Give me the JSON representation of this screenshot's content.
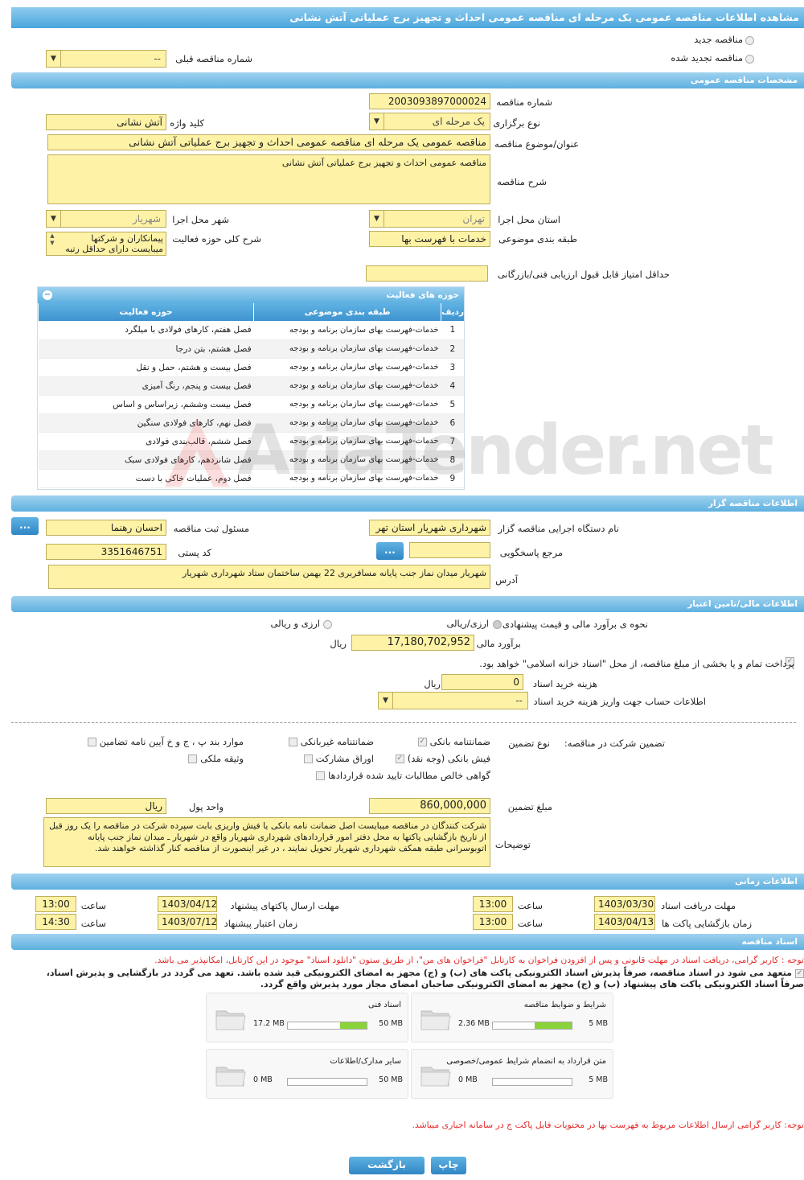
{
  "title": "مشاهده اطلاعات مناقصه عمومی یک مرحله ای مناقصه عمومی احداث و تجهیز برج عملیاتی آتش نشانی",
  "top": {
    "new_label": "مناقصه جدید",
    "renewed_label": "مناقصه تجدید شده",
    "prev_label": "شماره مناقصه قبلی",
    "prev_value": "--"
  },
  "general": {
    "header": "مشخصات مناقصه عمومی",
    "number_label": "شماره مناقصه",
    "number": "2003093897000024",
    "type_label": "نوع برگزاری",
    "type": "یک مرحله ای",
    "keyword_label": "کلید واژه",
    "keyword": "آتش نشانی",
    "subject_label": "عنوان/موضوع مناقصه",
    "subject": "مناقصه عمومی یک مرحله ای  مناقصه عمومی احداث و تجهیز برج عملیاتی آتش نشانی",
    "desc_label": "شرح مناقصه",
    "desc": "مناقصه عمومی احداث و تجهیز برج عملیاتی آتش نشانی",
    "province_label": "استان محل اجرا",
    "province": "تهران",
    "city_label": "شهر محل اجرا",
    "city": "شهریار",
    "category_label": "طبقه بندی موضوعی",
    "category": "خدمات با فهرست بها",
    "scope_label": "شرح کلی حوزه فعالیت",
    "scope": "پیمانکاران و شرکتها میبایست دارای حداقل رتبه",
    "min_score_label": "حداقل امتیاز قابل قبول ارزیابی فنی/بازرگانی",
    "min_score": ""
  },
  "activities": {
    "header": "حوزه های فعالیت",
    "cols": [
      "ردیف",
      "طبقه بندی موضوعی",
      "حوزه فعالیت"
    ],
    "rows": [
      [
        "1",
        "خدمات-فهرست بهای سازمان برنامه و بودجه",
        "فصل هفتم، کارهای فولادی با میلگرد"
      ],
      [
        "2",
        "خدمات-فهرست بهای سازمان برنامه و بودجه",
        "فصل هشتم، بتن درجا"
      ],
      [
        "3",
        "خدمات-فهرست بهای سازمان برنامه و بودجه",
        "فصل بیست و هشتم، حمل و نقل"
      ],
      [
        "4",
        "خدمات-فهرست بهای سازمان برنامه و بودجه",
        "فصل بیست و پنجم، رنگ آمیزی"
      ],
      [
        "5",
        "خدمات-فهرست بهای سازمان برنامه و بودجه",
        "فصل بیست وششم، زیراساس و اساس"
      ],
      [
        "6",
        "خدمات-فهرست بهای سازمان برنامه و بودجه",
        "فصل نهم، کارهای فولادی سنگین"
      ],
      [
        "7",
        "خدمات-فهرست بهای سازمان برنامه و بودجه",
        "فصل ششم، قالب‌بندی فولادی"
      ],
      [
        "8",
        "خدمات-فهرست بهای سازمان برنامه و بودجه",
        "فصل شانزدهم، کارهای فولادی سبک"
      ],
      [
        "9",
        "خدمات-فهرست بهای سازمان برنامه و بودجه",
        "فصل دوم، عملیات خاکی با دست"
      ]
    ]
  },
  "organizer": {
    "header": "اطلاعات مناقصه گزار",
    "org_label": "نام دستگاه اجرایی مناقصه گزار",
    "org": "شهرداری شهریار استان تهر",
    "officer_label": "مسئول ثبت مناقصه",
    "officer": "احسان رهنما",
    "ref_label": "مرجع پاسخگویی",
    "ref": "",
    "postal_label": "کد پستی",
    "postal": "3351646751",
    "address_label": "آدرس",
    "address": "شهریار میدان نماز  جنب پایانه مسافربری  22 بهمن ساختمان ستاد شهرداری شهریار",
    "btn": "..."
  },
  "finance": {
    "header": "اطلاعات مالی/تامین اعتبار",
    "method_label": "نحوه ی برآورد مالی و قیمت پیشنهادی",
    "opt1": "ارزی/ریالی",
    "opt2": "ارزی و ریالی",
    "estimate_label": "برآورد مالی",
    "estimate": "17,180,702,952",
    "rial": "ریال",
    "treasury": "پرداخت تمام و یا بخشی از مبلغ مناقصه، از محل \"اسناد خزانه اسلامی\" خواهد بود.",
    "doc_cost_label": "هزینه خرید اسناد",
    "doc_cost": "0",
    "account_label": "اطلاعات حساب جهت واریز هزینه خرید اسناد",
    "account": "--"
  },
  "guarantee": {
    "title_label": "تضمین شرکت در مناقصه:",
    "type_label": "نوع تضمین",
    "opts": [
      "ضمانتنامه بانکی",
      "ضمانتنامه غیربانکی",
      "موارد بند پ ، ج و خ آیین نامه تضامین",
      "فیش بانکی (وجه نقد)",
      "اوراق مشارکت",
      "وثیقه ملکی",
      "گواهی خالص مطالبات تایید شده قراردادها"
    ],
    "amount_label": "مبلغ تضمین",
    "amount": "860,000,000",
    "unit_label": "واحد پول",
    "unit": "ریال",
    "notes_label": "توضیحات",
    "notes": "شرکت کنندگان در مناقصه میبایست اصل ضمانت نامه بانکی یا فیش واریزی بابت سپرده شرکت در مناقصه را یک روز قبل از تاریخ بازگشایی پاکتها به محل دفتر امور قراردادهای شهرداری شهریار واقع در شهریار ـ میدان نماز جنب پایانه اتوبوسرانی طبقه همکف شهرداری شهریار تحویل نمایند ، در غیر اینصورت از مناقصه کنار گذاشته خواهند شد."
  },
  "timing": {
    "header": "اطلاعات زمانی",
    "receive_label": "مهلت دریافت اسناد",
    "receive_date": "1403/03/30",
    "receive_time": "13:00",
    "send_label": "مهلت ارسال پاکتهای پیشنهاد",
    "send_date": "1403/04/12",
    "send_time": "13:00",
    "open_label": "زمان بازگشایی پاکت ها",
    "open_date": "1403/04/13",
    "open_time": "13:00",
    "valid_label": "زمان اعتبار پیشنهاد",
    "valid_date": "1403/07/12",
    "valid_time": "14:30",
    "time_label": "ساعت"
  },
  "docs": {
    "header": "اسناد مناقصه",
    "note1": "توجه : کاربر گرامی، دریافت اسناد در مهلت قانونی و پس از افزودن فراخوان به کارتابل \"فراخوان های من\"، از طریق ستون \"دانلود اسناد\" موجود در این کارتابل، امکانپذیر می باشد.",
    "note2": "متعهد می شود در اسناد مناقصه، صرفاً پذیرش اسناد الکترونیکی پاکت های (ب) و (ج) مجهز به امضای الکترونیکی قید شده باشد. تعهد می گردد در بازگشایی و پذیرش اسناد،",
    "note3": "صرفاً اسناد الکترونیکی پاکت های پیشنهاد (ب) و (ج) مجهز به امضای الکترونیکی صاحبان امضای مجاز مورد پذیرش واقع گردد.",
    "files": [
      {
        "name": "شرایط و ضوابط مناقصه",
        "current": "2.36 MB",
        "max": "5 MB",
        "fill": 0.47
      },
      {
        "name": "اسناد فنی",
        "current": "17.2 MB",
        "max": "50 MB",
        "fill": 0.34
      },
      {
        "name": "متن قرارداد به انضمام شرایط عمومی/خصوصی",
        "current": "0 MB",
        "max": "5 MB",
        "fill": 0
      },
      {
        "name": "سایر مدارک/اطلاعات",
        "current": "0 MB",
        "max": "50 MB",
        "fill": 0
      }
    ],
    "note4": "توجه: کاربر گرامی ارسال اطلاعات مربوط به فهرست بها در محتویات فایل پاکت ج در سامانه اجباری میباشد."
  },
  "actions": {
    "print": "چاپ",
    "back": "بازگشت"
  },
  "watermark": "AriaTender.net"
}
